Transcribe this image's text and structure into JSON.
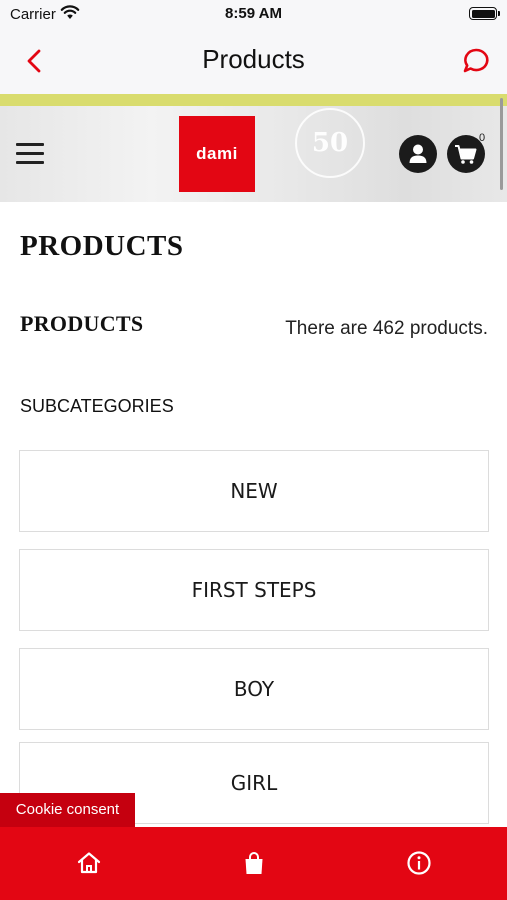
{
  "status_bar": {
    "carrier": "Carrier",
    "time": "8:59 AM"
  },
  "nav": {
    "title": "Products"
  },
  "header": {
    "logo_text": "dami",
    "badge_text": "50",
    "cart_count": "0"
  },
  "content": {
    "page_heading": "PRODUCTS",
    "sub_heading": "PRODUCTS",
    "product_count": "There are 462 products.",
    "subcategories_label": "SUBCATEGORIES",
    "categories": [
      "NEW",
      "FIRST STEPS",
      "BOY",
      "GIRL"
    ]
  },
  "cookie": {
    "label": "Cookie consent"
  },
  "colors": {
    "brand_red": "#e30613",
    "accent_line": "#d9dc6e",
    "cookie_red": "#c5000f"
  },
  "icons": [
    "wifi-icon",
    "battery-icon",
    "back-chevron-icon",
    "chat-bubble-icon",
    "hamburger-menu-icon",
    "account-icon",
    "cart-icon",
    "home-icon",
    "shopping-bag-icon",
    "info-icon"
  ]
}
